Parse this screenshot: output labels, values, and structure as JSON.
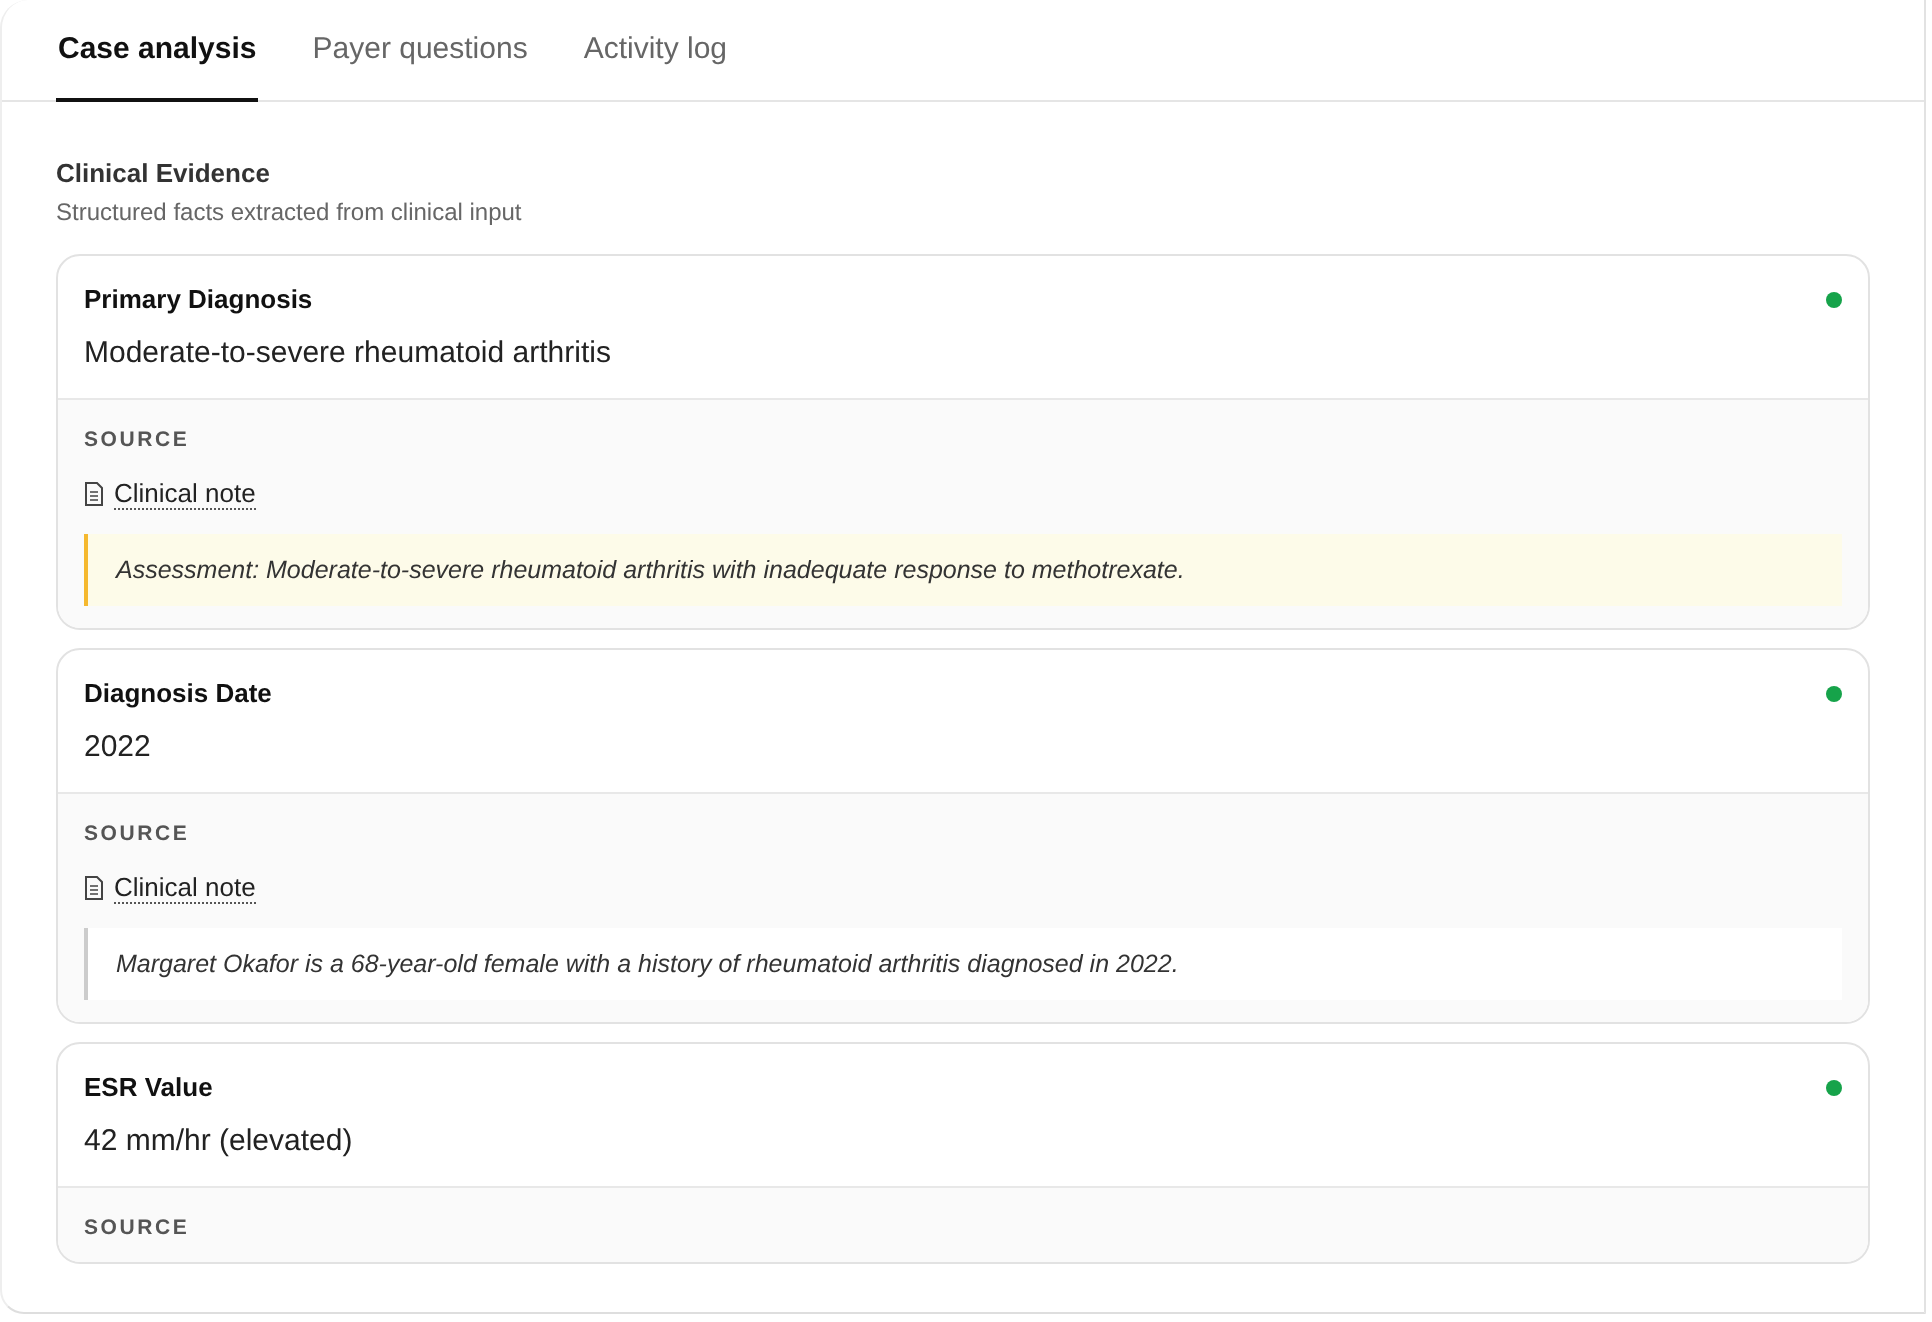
{
  "tabs": [
    {
      "label": "Case analysis",
      "selected": true
    },
    {
      "label": "Payer questions",
      "selected": false
    },
    {
      "label": "Activity log",
      "selected": false
    }
  ],
  "section": {
    "title": "Clinical Evidence",
    "subtitle": "Structured facts extracted from clinical input"
  },
  "facts": [
    {
      "label": "Primary Diagnosis",
      "value": "Moderate-to-severe rheumatoid arthritis",
      "color": "#16a34a",
      "source_heading": "SOURCE",
      "source_link": "Clinical note",
      "quote": "Assessment: Moderate-to-severe rheumatoid arthritis with inadequate response to methotrexate.",
      "highlighted": true
    },
    {
      "label": "Diagnosis Date",
      "value": "2022",
      "color": "#16a34a",
      "source_heading": "SOURCE",
      "source_link": "Clinical note",
      "quote": "Margaret Okafor is a 68-year-old female with a history of rheumatoid arthritis diagnosed in 2022.",
      "highlighted": false
    },
    {
      "label": "ESR Value",
      "value": "42 mm/hr (elevated)",
      "color": "#16a34a",
      "source_heading": "SOURCE"
    }
  ]
}
